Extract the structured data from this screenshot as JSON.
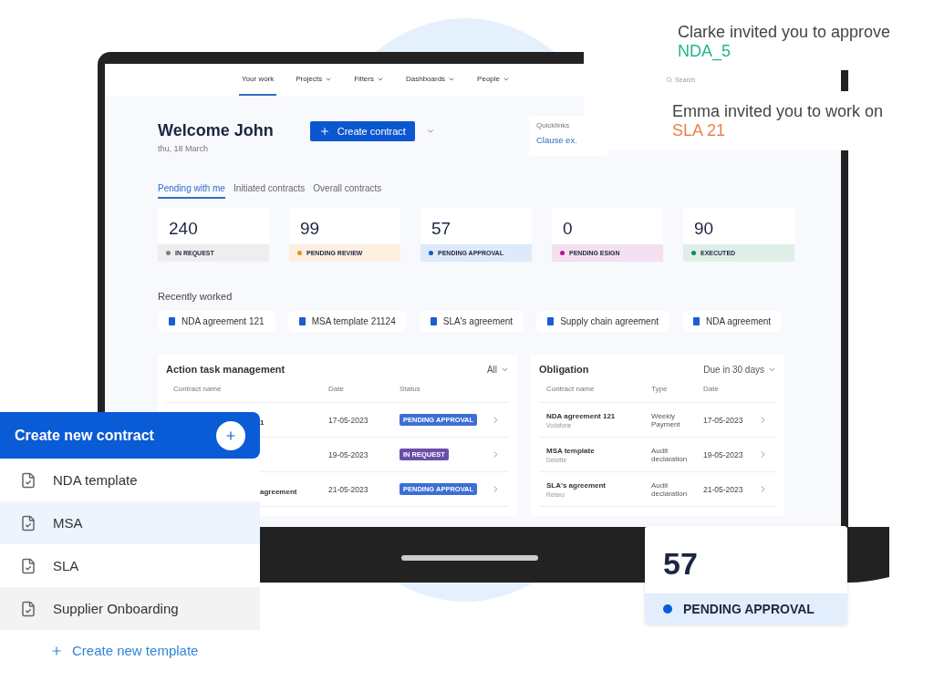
{
  "nav": {
    "items": [
      {
        "label": "Your work",
        "selected": true,
        "dropdown": false
      },
      {
        "label": "Projects",
        "selected": false,
        "dropdown": true
      },
      {
        "label": "Filters",
        "selected": false,
        "dropdown": true
      },
      {
        "label": "Dashboards",
        "selected": false,
        "dropdown": true
      },
      {
        "label": "People",
        "selected": false,
        "dropdown": true
      }
    ],
    "search": {
      "placeholder": "Search"
    }
  },
  "header": {
    "title": "Welcome John",
    "date": "thu, 18 March",
    "create_button": "Create contract"
  },
  "quicklinks": {
    "title": "Quicklinks",
    "link": "Clause ex."
  },
  "tabs": [
    {
      "label": "Pending with me",
      "selected": true
    },
    {
      "label": "Initiated contracts",
      "selected": false
    },
    {
      "label": "Overall contracts",
      "selected": false
    }
  ],
  "stats": [
    {
      "value": "240",
      "label": "IN REQUEST",
      "color": "#7c7f86"
    },
    {
      "value": "99",
      "label": "PENDING REVIEW",
      "color": "#f08c1c"
    },
    {
      "value": "57",
      "label": "PENDING APPROVAL",
      "color": "#0b5cd6"
    },
    {
      "value": "0",
      "label": "PENDING ESIGN",
      "color": "#b0168f"
    },
    {
      "value": "90",
      "label": "EXECUTED",
      "color": "#0d8a4f"
    }
  ],
  "recently_worked": {
    "title": "Recently worked",
    "items": [
      "NDA agreement 121",
      "MSA template 21124",
      "SLA's agreement",
      "Supply chain agreement",
      "NDA agreement"
    ]
  },
  "action_tasks": {
    "title": "Action task management",
    "filter": "All",
    "columns": [
      "Contract name",
      "Date",
      "Status"
    ],
    "rows": [
      {
        "name": "1",
        "date": "17-05-2023",
        "status": "PENDING APPROVAL",
        "color": "#3b6fd4"
      },
      {
        "date": "19-05-2023",
        "status": "IN REQUEST",
        "color": "#6a4fa8"
      },
      {
        "name": "agreement",
        "date": "21-05-2023",
        "status": "PENDING APPROVAL",
        "color": "#3b6fd4"
      }
    ]
  },
  "obligation": {
    "title": "Obligation",
    "filter": "Due in 30 days",
    "columns": [
      "Contract name",
      "Type",
      "Date"
    ],
    "rows": [
      {
        "name": "NDA agreement 121",
        "company": "Vodafone",
        "type": "Weekly Payment",
        "date": "17-05-2023"
      },
      {
        "name": "MSA template",
        "company": "Deloitte",
        "type": "Audit declaration",
        "date": "19-05-2023"
      },
      {
        "name": "SLA's agreement",
        "company": "Relaxo",
        "type": "Audit declaration",
        "date": "21-05-2023"
      }
    ]
  },
  "create_menu": {
    "button": "Create new contract",
    "templates": [
      {
        "label": "NDA template",
        "selected": false,
        "hovered": false
      },
      {
        "label": "MSA",
        "selected": true,
        "hovered": false
      },
      {
        "label": "SLA",
        "selected": false,
        "hovered": false
      },
      {
        "label": "Supplier Onboarding",
        "selected": false,
        "hovered": true
      }
    ],
    "link": "Create new template"
  },
  "notifications": [
    {
      "text": "Clarke invited you to approve",
      "link": "NDA_5",
      "color": "#1fb58f"
    },
    {
      "text": "Emma invited you to work on",
      "link": "SLA 21",
      "color": "#ef7d4a"
    }
  ],
  "highlight_card": {
    "value": "57",
    "label": "PENDING APPROVAL",
    "color": "#0b5cd6"
  }
}
